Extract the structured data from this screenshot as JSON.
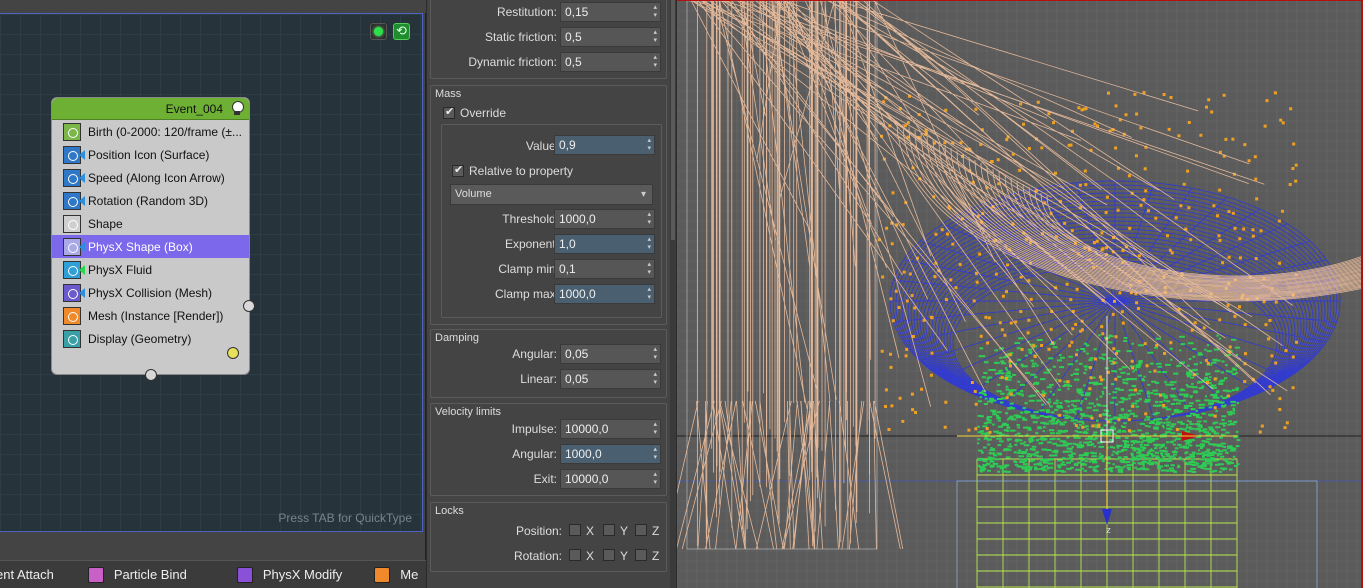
{
  "particle_view": {
    "quicktype_hint": "Press TAB for QuickType",
    "event": {
      "title": "Event_004",
      "operators": [
        {
          "label": "Birth (0-2000: 120/frame (±...",
          "icon": "birth-icon",
          "color": "#7ab648"
        },
        {
          "label": "Position Icon (Surface)",
          "icon": "position-icon",
          "color": "#2f77c7"
        },
        {
          "label": "Speed (Along Icon Arrow)",
          "icon": "speed-icon",
          "color": "#2f77c7"
        },
        {
          "label": "Rotation (Random 3D)",
          "icon": "rotation-icon",
          "color": "#2f77c7"
        },
        {
          "label": "Shape",
          "icon": "shape-icon",
          "color": "#cfcfcf"
        },
        {
          "label": "PhysX Shape (Box)",
          "icon": "physx-shape-icon",
          "color": "#a9a9e8"
        },
        {
          "label": "PhysX Fluid",
          "icon": "physx-fluid-icon",
          "color": "#2f9fd8"
        },
        {
          "label": "PhysX Collision (Mesh)",
          "icon": "physx-collision-icon",
          "color": "#6a5acd"
        },
        {
          "label": "Mesh (Instance [Render])",
          "icon": "mesh-icon",
          "color": "#f0892a"
        },
        {
          "label": "Display (Geometry)",
          "icon": "display-icon",
          "color": "#3aa0a8"
        }
      ],
      "selected_index": 5
    },
    "depot": [
      {
        "label": "ent Attach",
        "icon": "attach-icon",
        "color": "#3b3b3b"
      },
      {
        "label": "Particle Bind",
        "icon": "particle-bind-icon",
        "color": "#c860c8"
      },
      {
        "label": "PhysX Modify",
        "icon": "physx-modify-icon",
        "color": "#8a50d8"
      },
      {
        "label": "Me",
        "icon": "mesh-depot-icon",
        "color": "#f0892a"
      }
    ]
  },
  "panel": {
    "top_rows": [
      {
        "label": "Restitution:",
        "value": "0,15"
      },
      {
        "label": "Static friction:",
        "value": "0,5"
      },
      {
        "label": "Dynamic friction:",
        "value": "0,5"
      }
    ],
    "mass": {
      "title": "Mass",
      "override_label": "Override",
      "override_checked": true,
      "value_label": "Value:",
      "value": "0,9",
      "relative_label": "Relative to property",
      "relative_checked": true,
      "property": "Volume",
      "rows": [
        {
          "label": "Threshold:",
          "value": "1000,0"
        },
        {
          "label": "Exponent:",
          "value": "1,0"
        },
        {
          "label": "Clamp min:",
          "value": "0,1"
        },
        {
          "label": "Clamp max:",
          "value": "1000,0"
        }
      ]
    },
    "damping": {
      "title": "Damping",
      "rows": [
        {
          "label": "Angular:",
          "value": "0,05"
        },
        {
          "label": "Linear:",
          "value": "0,05"
        }
      ]
    },
    "velocity": {
      "title": "Velocity limits",
      "rows": [
        {
          "label": "Impulse:",
          "value": "10000,0"
        },
        {
          "label": "Angular:",
          "value": "1000,0"
        },
        {
          "label": "Exit:",
          "value": "10000,0"
        }
      ]
    },
    "locks": {
      "title": "Locks",
      "position_label": "Position:",
      "rotation_label": "Rotation:",
      "x": "X",
      "y": "Y",
      "z": "Z"
    }
  },
  "viewport": {
    "axis_label": "z",
    "colors": {
      "wire": "#f2c2a0",
      "blue": "#2b36e0",
      "green": "#2ecc55",
      "orange": "#f0a020",
      "grid": "#6a6a6a",
      "box": "#b8e84c"
    }
  }
}
